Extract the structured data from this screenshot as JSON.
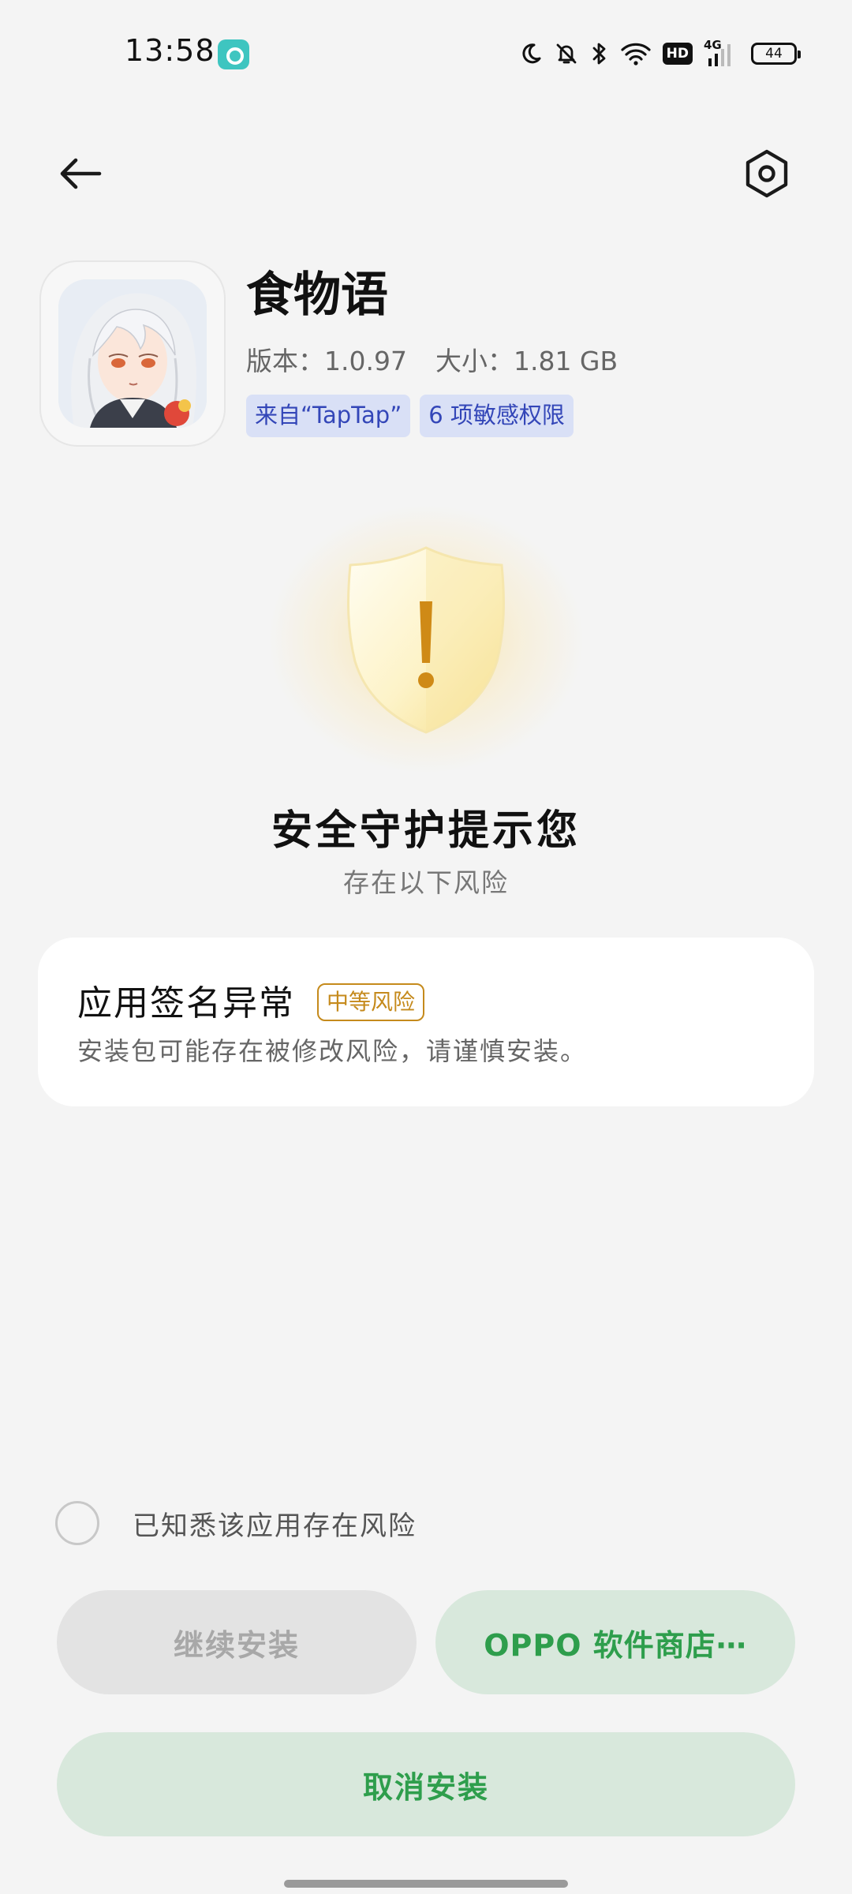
{
  "status_bar": {
    "time": "13:58",
    "app_notification_icon": "message-bubble-icon",
    "hd_label": "HD",
    "network_label": "4G",
    "battery_level": "44",
    "icons": [
      "moon-icon",
      "bell-muted-icon",
      "bluetooth-icon",
      "wifi-icon",
      "hd-icon",
      "cellular-signal-icon",
      "battery-icon"
    ]
  },
  "nav": {
    "back_icon": "arrow-left-icon",
    "settings_icon": "hexagon-gear-icon"
  },
  "app": {
    "name": "食物语",
    "version_label": "版本：",
    "version": "1.0.97",
    "size_label": "大小：",
    "size": "1.81 GB",
    "tags": [
      "来自“TapTap”",
      "6 项敏感权限"
    ]
  },
  "guard": {
    "icon": "warning-shield-icon",
    "title": "安全守护提示您",
    "subtitle": "存在以下风险"
  },
  "risk": {
    "title": "应用签名异常",
    "level": "中等风险",
    "description": "安装包可能存在被修改风险，请谨慎安装。"
  },
  "acknowledge": {
    "label": "已知悉该应用存在风险",
    "checked": false
  },
  "buttons": {
    "continue": "继续安装",
    "store": "OPPO 软件商店⋯",
    "cancel": "取消安装"
  },
  "colors": {
    "accent_green": "#2e9e4c",
    "risk_amber": "#c58a1c",
    "tag_blue": "#3346b8"
  }
}
